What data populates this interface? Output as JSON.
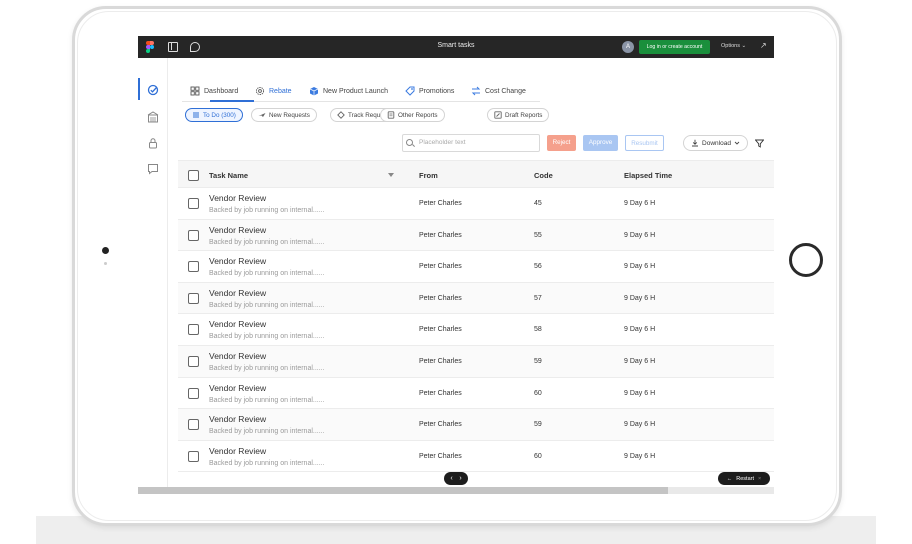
{
  "topbar": {
    "title": "Smart tasks",
    "avatar_initial": "A",
    "login_label": "Log in or create account",
    "options_label": "Options ⌄",
    "expand_glyph": "↗"
  },
  "tabs": [
    {
      "label": "Dashboard",
      "icon": "grid-icon"
    },
    {
      "label": "Rebate",
      "icon": "gear-icon",
      "active": true
    },
    {
      "label": "New Product Launch",
      "icon": "box-icon"
    },
    {
      "label": "Promotions",
      "icon": "tag-icon"
    },
    {
      "label": "Cost Change",
      "icon": "swap-icon"
    }
  ],
  "chips": [
    {
      "label": "To Do (300)",
      "icon": "list-icon",
      "active": true
    },
    {
      "label": "New Requests",
      "icon": "plane-icon"
    },
    {
      "label": "Track Requests",
      "icon": "target-icon"
    },
    {
      "label": "Other Reports",
      "icon": "document-icon"
    },
    {
      "label": "Draft Reports",
      "icon": "edit-icon"
    }
  ],
  "search": {
    "placeholder": "Placeholder text"
  },
  "actions": {
    "reject": "Reject",
    "approve": "Approve",
    "resubmit": "Resubmit",
    "download": "Download"
  },
  "table": {
    "columns": {
      "task": "Task Name",
      "from": "From",
      "code": "Code",
      "elapsed": "Elapsed Time"
    },
    "rows": [
      {
        "title": "Vendor Review",
        "subtitle": "Backed by job running on internal......",
        "from": "Peter Charles",
        "code": "45",
        "elapsed": "9 Day 6 H"
      },
      {
        "title": "Vendor Review",
        "subtitle": "Backed by job running on internal......",
        "from": "Peter Charles",
        "code": "55",
        "elapsed": "9 Day 6 H"
      },
      {
        "title": "Vendor Review",
        "subtitle": "Backed by job running on internal......",
        "from": "Peter Charles",
        "code": "56",
        "elapsed": "9 Day 6 H"
      },
      {
        "title": "Vendor Review",
        "subtitle": "Backed by job running on internal......",
        "from": "Peter Charles",
        "code": "57",
        "elapsed": "9 Day 6 H"
      },
      {
        "title": "Vendor Review",
        "subtitle": "Backed by job running on internal......",
        "from": "Peter Charles",
        "code": "58",
        "elapsed": "9 Day 6 H"
      },
      {
        "title": "Vendor Review",
        "subtitle": "Backed by job running on internal......",
        "from": "Peter Charles",
        "code": "59",
        "elapsed": "9 Day 6 H"
      },
      {
        "title": "Vendor Review",
        "subtitle": "Backed by job running on internal......",
        "from": "Peter Charles",
        "code": "60",
        "elapsed": "9 Day 6 H"
      },
      {
        "title": "Vendor Review",
        "subtitle": "Backed by job running on internal......",
        "from": "Peter Charles",
        "code": "59",
        "elapsed": "9 Day 6 H"
      },
      {
        "title": "Vendor Review",
        "subtitle": "Backed by job running on internal......",
        "from": "Peter Charles",
        "code": "60",
        "elapsed": "9 Day 6 H"
      }
    ]
  },
  "pager": {
    "prev": "‹",
    "next": "›"
  },
  "restart": {
    "arrow": "←",
    "label": "Restart",
    "close": "×"
  },
  "colors": {
    "accent": "#2f6fd6",
    "login": "#1a8f3c",
    "reject": "#f5a08c",
    "approve": "#a9c6f2",
    "topbar": "#262626"
  }
}
